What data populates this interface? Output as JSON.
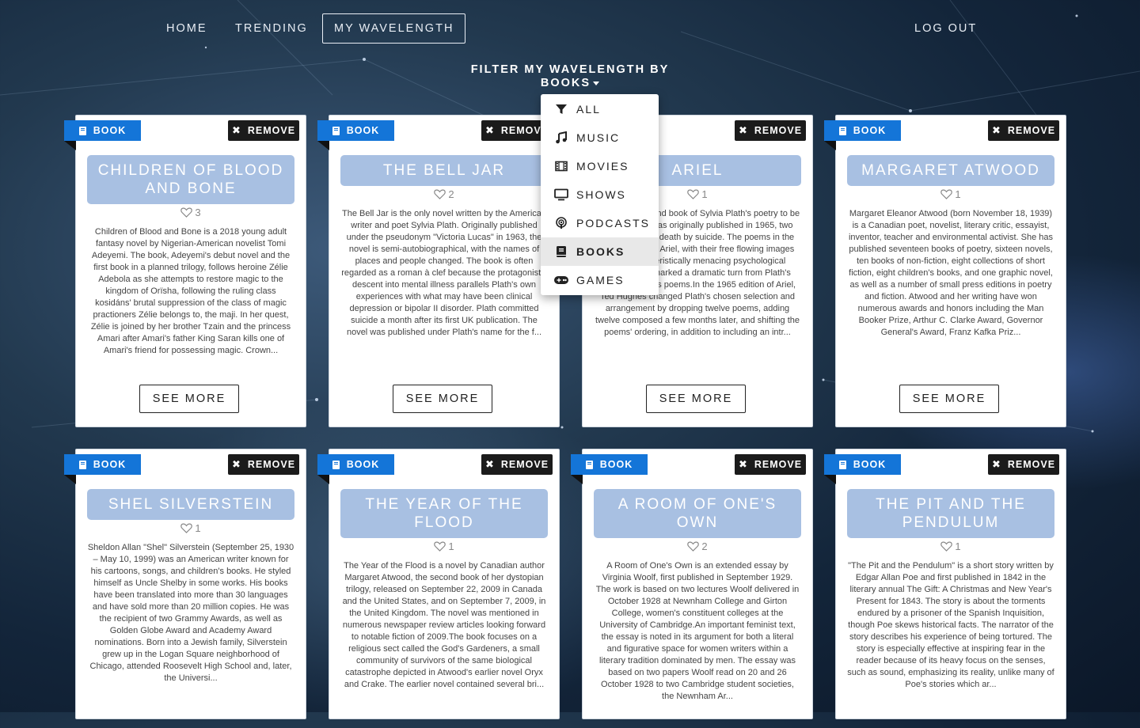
{
  "nav": {
    "home": "HOME",
    "trending": "TRENDING",
    "my_wavelength": "MY WAVELENGTH",
    "logout": "LOG OUT"
  },
  "filter": {
    "label": "FILTER MY WAVELENGTH BY",
    "selected": "BOOKS",
    "options": [
      {
        "label": "ALL",
        "icon": "filter-icon"
      },
      {
        "label": "MUSIC",
        "icon": "music-note-icon"
      },
      {
        "label": "MOVIES",
        "icon": "film-icon"
      },
      {
        "label": "SHOWS",
        "icon": "tv-icon"
      },
      {
        "label": "PODCASTS",
        "icon": "podcast-icon"
      },
      {
        "label": "BOOKS",
        "icon": "book-icon"
      },
      {
        "label": "GAMES",
        "icon": "gamepad-icon"
      }
    ]
  },
  "card_labels": {
    "type": "BOOK",
    "remove": "REMOVE",
    "see_more": "SEE MORE"
  },
  "cards": [
    {
      "title": "CHILDREN OF BLOOD AND BONE",
      "likes": "3",
      "description": "Children of Blood and Bone is a 2018 young adult fantasy novel by Nigerian-American novelist Tomi Adeyemi. The book, Adeyemi's debut novel and the first book in a planned trilogy, follows heroine Zélie Adebola as she attempts to restore magic to the kingdom of Orïsha, following the ruling class kosidáns' brutal suppression of the class of magic practioners Zélie belongs to, the maji. In her quest, Zélie is joined by her brother Tzain and the princess Amari after Amari's father King Saran kills one of Amari's friend for possessing magic. Crown..."
    },
    {
      "title": "THE BELL JAR",
      "likes": "2",
      "description": "The Bell Jar is the only novel written by the American writer and poet Sylvia Plath. Originally published under the pseudonym \"Victoria Lucas\" in 1963, the novel is semi-autobiographical, with the names of places and people changed. The book is often regarded as a roman à clef because the protagonist's descent into mental illness parallels Plath's own experiences with what may have been clinical depression or bipolar II disorder. Plath committed suicide a month after its first UK publication. The novel was published under Plath's name for the f..."
    },
    {
      "title": "ARIEL",
      "likes": "1",
      "description": "Ariel is the second book of Sylvia Plath's poetry to be published. It was originally published in 1965, two years after her death by suicide. The poems in the 1965 edition of Ariel, with their free flowing images and characteristically menacing psychological landscapes, marked a dramatic turn from Plath's earlier Colossus poems.In the 1965 edition of Ariel, Ted Hughes changed Plath's chosen selection and arrangement by dropping twelve poems, adding twelve composed a few months later, and shifting the poems' ordering, in addition to including an intr..."
    },
    {
      "title": "MARGARET ATWOOD",
      "likes": "1",
      "description": "Margaret Eleanor Atwood (born November 18, 1939) is a Canadian poet, novelist, literary critic, essayist, inventor, teacher and environmental activist. She has published seventeen books of poetry, sixteen novels, ten books of non-fiction, eight collections of short fiction, eight children's books, and one graphic novel, as well as a number of small press editions in poetry and fiction. Atwood and her writing have won numerous awards and honors including the Man Booker Prize, Arthur C. Clarke Award, Governor General's Award, Franz Kafka Priz..."
    },
    {
      "title": "SHEL SILVERSTEIN",
      "likes": "1",
      "description": "Sheldon Allan \"Shel\" Silverstein (September 25, 1930 – May 10, 1999) was an American writer known for his cartoons, songs, and children's books. He styled himself as Uncle Shelby in some works. His books have been translated into more than 30 languages and have sold more than 20 million copies. He was the recipient of two Grammy Awards, as well as Golden Globe Award and Academy Award nominations. Born into a Jewish family, Silverstein grew up in the Logan Square neighborhood of Chicago, attended Roosevelt High School and, later, the Universi..."
    },
    {
      "title": "THE YEAR OF THE FLOOD",
      "likes": "1",
      "description": "The Year of the Flood is a novel by Canadian author Margaret Atwood, the second book of her dystopian trilogy, released on September 22, 2009 in Canada and the United States, and on September 7, 2009, in the United Kingdom. The novel was mentioned in numerous newspaper review articles looking forward to notable fiction of 2009.The book focuses on a religious sect called the God's Gardeners, a small community of survivors of the same biological catastrophe depicted in Atwood's earlier novel Oryx and Crake. The earlier novel contained several bri..."
    },
    {
      "title": "A ROOM OF ONE'S OWN",
      "likes": "2",
      "description": "A Room of One's Own is an extended essay by Virginia Woolf, first published in September 1929. The work is based on two lectures Woolf delivered in October 1928 at Newnham College and Girton College, women's constituent colleges at the University of Cambridge.An important feminist text, the essay is noted in its argument for both a literal and figurative space for women writers within a literary tradition dominated by men. The essay was based on two papers Woolf read on 20 and 26 October 1928 to two Cambridge student societies, the Newnham Ar..."
    },
    {
      "title": "THE PIT AND THE PENDULUM",
      "likes": "1",
      "description": "\"The Pit and the Pendulum\" is a short story written by Edgar Allan Poe and first published in 1842 in the literary annual The Gift: A Christmas and New Year's Present for 1843. The story is about the torments endured by a prisoner of the Spanish Inquisition, though Poe skews historical facts. The narrator of the story describes his experience of being tortured. The story is especially effective at inspiring fear in the reader because of its heavy focus on the senses, such as sound, emphasizing its reality, unlike many of Poe's stories which ar..."
    }
  ],
  "colors": {
    "type_ribbon": "#1475d8",
    "title_box": "#a8c0e2",
    "remove_button": "#1b1b1b"
  }
}
